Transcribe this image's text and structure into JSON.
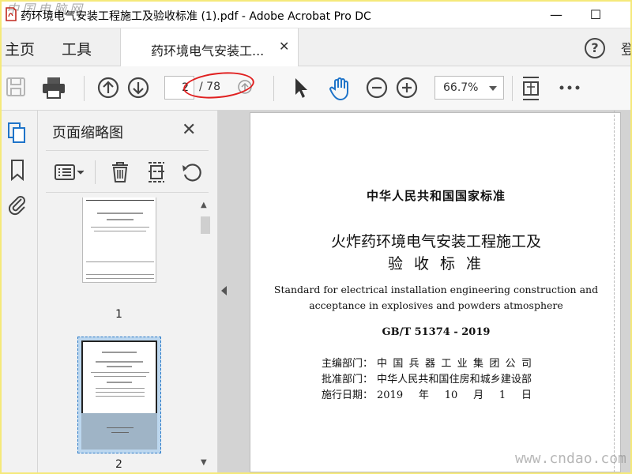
{
  "window": {
    "title": "药环境电气安装工程施工及验收标准 (1).pdf - Adobe Acrobat Pro DC",
    "watermark_top": "中国电脑网",
    "minimize": "—",
    "maximize": "☐"
  },
  "tabs": {
    "home": "主页",
    "tools": "工具",
    "doc_tab": "药环境电气安装工...",
    "close": "✕",
    "help": "?",
    "signin": "登"
  },
  "toolbar": {
    "current_page": "2",
    "total_pages": "/ 78",
    "zoom": "66.7%"
  },
  "panel": {
    "title": "页面缩略图",
    "close": "✕",
    "thumbnails": [
      {
        "label": "1"
      },
      {
        "label": "2"
      }
    ]
  },
  "page": {
    "standard_header": "中华人民共和国国家标准",
    "title_line1": "火炸药环境电气安装工程施工及",
    "title_line2": "验 收 标 准",
    "english_line1": "Standard for electrical installation engineering construction and",
    "english_line2": "acceptance in explosives and powders atmosphere",
    "code": "GB/T 51374 - 2019",
    "rows": [
      {
        "label": "主编部门：",
        "value": "中国兵器工业集团公司"
      },
      {
        "label": "批准部门：",
        "value": "中华人民共和国住房和城乡建设部"
      },
      {
        "label": "施行日期：",
        "value": "2019年10月1日"
      }
    ]
  },
  "footer": {
    "watermark": "www.cndao.com"
  },
  "colors": {
    "accent": "#2a7ac8",
    "annotation": "#e02020",
    "app_icon": "#c0281e"
  }
}
